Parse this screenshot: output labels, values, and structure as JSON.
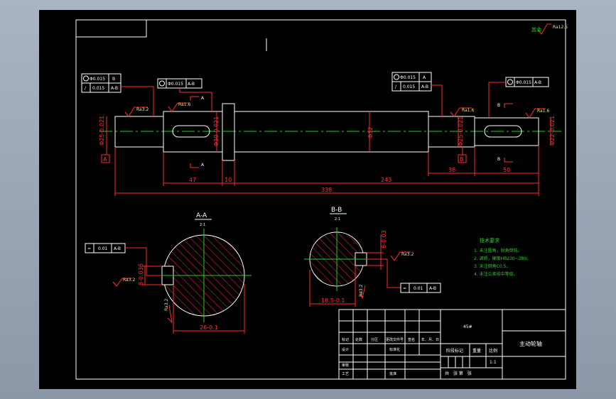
{
  "tolerance_frames": {
    "left_top": {
      "conc_value": "Φ0.015",
      "conc_datum": "B",
      "runout_value": "0.015",
      "runout_datum": "A-B"
    },
    "left_second": {
      "value": "Φ0.015",
      "datum": "A-B"
    },
    "right_top": {
      "conc_value": "Φ0.015",
      "conc_datum": "A",
      "runout_value": "0.015",
      "runout_datum": "A-B"
    },
    "right_second": {
      "value": "Φ0.015",
      "datum": "A-B"
    },
    "section_a": {
      "symbol": "=",
      "value": "0.01",
      "datum": "A-B"
    },
    "section_b": {
      "symbol": "=",
      "value": "0.01",
      "datum": "A-B"
    }
  },
  "datums": {
    "a": "A",
    "b": "B"
  },
  "section_marks": {
    "a_top": "A",
    "a_bottom": "A",
    "b_top": "B",
    "b_bottom": "B"
  },
  "dimensions": {
    "d_left": "Φ25-0.021",
    "d_key": "Φ30-0.021",
    "d_mid": "Φ32",
    "d_right_brg": "Φ25-0.021",
    "d_right_end": "Φ22-0.021",
    "len_47": "47",
    "len_10": "10",
    "len_243": "243",
    "len_338": "338",
    "len_38": "38",
    "len_50": "50",
    "sec_a_width": "8-0.036",
    "sec_a_depth": "26-0.1",
    "sec_b_width": "6-0.03",
    "sec_b_depth": "18.5-0.1"
  },
  "roughness": {
    "r1": "Ra3.2",
    "r2": "Ra1.6",
    "r3": "Ra1.6",
    "r4": "Ra1.6",
    "r5": "Ra12.5",
    "r6": "Ra3.2",
    "r7": "Ra3.2",
    "r8": "Ra3.2",
    "r9": "Ra3.2",
    "corner": "Ra12.5"
  },
  "sections": {
    "a_title": "A-A",
    "a_scale": "2:1",
    "b_title": "B-B",
    "b_scale": "2:1"
  },
  "tech_notes": {
    "title": "技术要求",
    "items": [
      "1. 未注圆角，锐角倒钝。",
      "2. 调质，硬度HB230~280。",
      "3. 未注倒角C0.5。",
      "4. 未注公差按中等级。"
    ]
  },
  "title_block": {
    "material": "45#",
    "part_name": "主动轮轴",
    "scale": "1:1",
    "headers": [
      "标记",
      "处数",
      "分区",
      "更改文件号",
      "签名",
      "年、月、日"
    ],
    "row_design": "设计",
    "row_standard": "标准化",
    "stage_label": "阶段标记",
    "weight_label": "重量",
    "scale_label": "比例",
    "review": "审核",
    "process": "工艺",
    "approve": "批准",
    "sheets": "共　张  第　张"
  },
  "colors": {
    "outline": "#ffffff",
    "dimension": "#ff2a2a",
    "center": "#1fd21f",
    "frame": "#9aa7b6"
  }
}
